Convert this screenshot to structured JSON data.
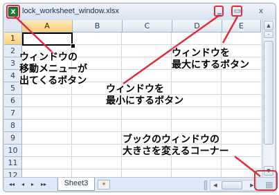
{
  "window": {
    "title": "lock_worksheet_window.xlsx",
    "minimize_glyph": "‗",
    "maximize_glyph": "▭",
    "close_glyph": "x",
    "app_icon": "excel-icon",
    "app_icon_glyph": "X"
  },
  "grid": {
    "columns": [
      "A",
      "B",
      "C",
      "D",
      "E"
    ],
    "rows": [
      "1",
      "2",
      "3",
      "4",
      "5",
      "6",
      "7",
      "8",
      "9",
      "10",
      "11",
      "12"
    ],
    "active_cell": "A1"
  },
  "bottom": {
    "nav": [
      "◂◂",
      "◂",
      "▸",
      "▸▸"
    ],
    "sheet_tab": "Sheet3",
    "new_sheet_icon": "insert-sheet-icon",
    "new_sheet_glyph": "✦"
  },
  "annotations": {
    "move_menu": [
      "ウィンドウの",
      "移動メニューが",
      "出てくるボタン"
    ],
    "maximize": [
      "ウィンドウを",
      "最大にするボタン"
    ],
    "minimize": [
      "ウィンドウを",
      "最小にするボタン"
    ],
    "resize_corner": [
      "ブックのウィンドウの",
      "大きさを変えるコーナー"
    ]
  },
  "colors": {
    "accent": "#e22a3a",
    "header_selected": "#f9cf7b"
  }
}
